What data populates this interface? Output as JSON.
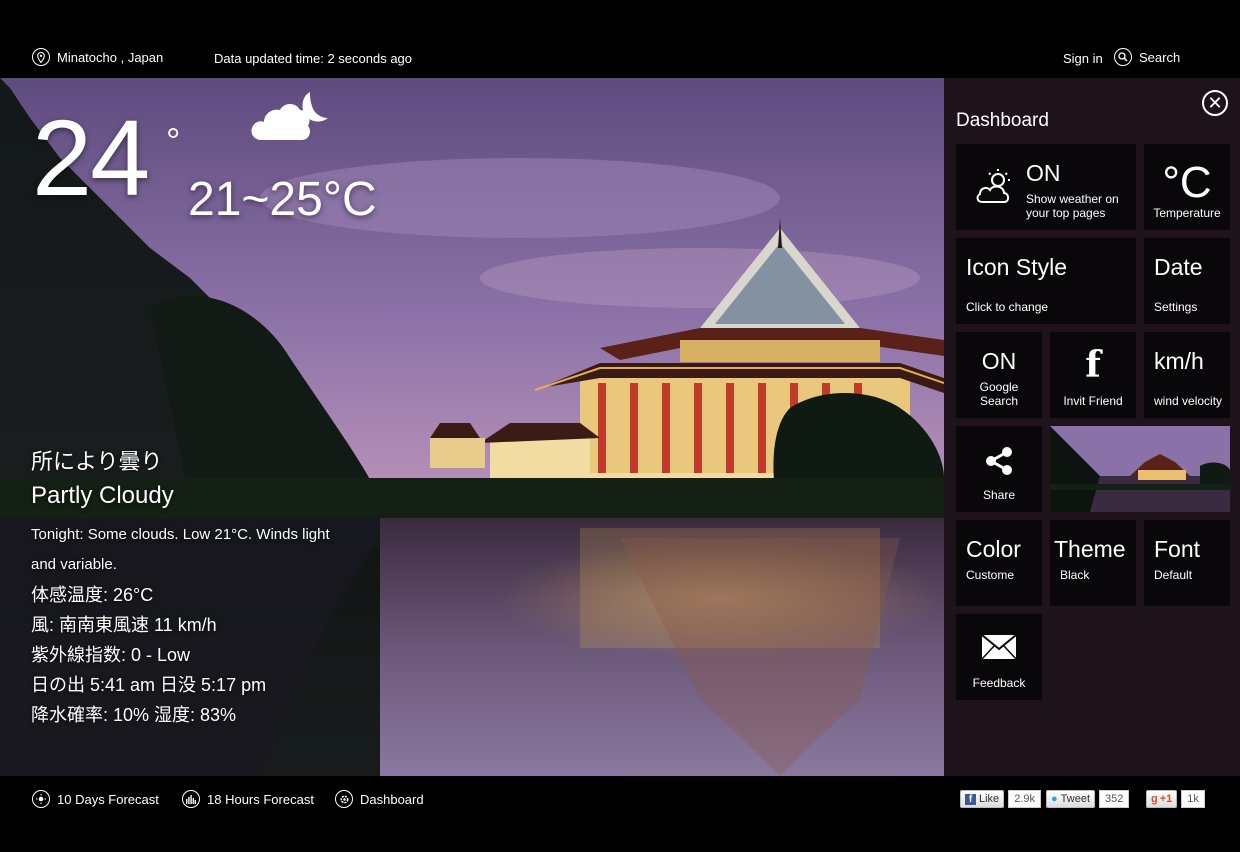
{
  "top": {
    "location": "Minatocho , Japan",
    "updated": "Data updated time: 2 seconds ago",
    "signin": "Sign in",
    "search": "Search"
  },
  "weather": {
    "temp": "24",
    "deg": "°",
    "range": "21~25°C",
    "cond_ja": "所により曇り",
    "cond_en": "Partly Cloudy",
    "desc": "Tonight: Some clouds. Low 21°C. Winds light and variable.",
    "feels": "体感温度: 26°C",
    "wind": "風: 南南東風速 11 km/h",
    "uv": "紫外線指数: 0 - Low",
    "sun": "日の出 5:41 am 日没 5:17 pm",
    "precip": "降水確率: 10% 湿度: 83%",
    "icon": "cloud-moon-icon"
  },
  "dashboard": {
    "title": "Dashboard",
    "weather_toggle": {
      "state": "ON",
      "label": "Show weather on your top pages"
    },
    "temperature": {
      "unit": "°C",
      "label": "Temperature"
    },
    "icon_style": {
      "title": "Icon Style",
      "label": "Click to change"
    },
    "date": {
      "title": "Date",
      "label": "Settings"
    },
    "google": {
      "state": "ON",
      "label": "Google Search"
    },
    "invite": {
      "glyph": "f",
      "label": "Invit Friend"
    },
    "wind": {
      "unit": "km/h",
      "label": "wind velocity"
    },
    "share": {
      "label": "Share"
    },
    "color": {
      "title": "Color",
      "label": "Custome"
    },
    "theme": {
      "title": "Theme",
      "label": "Black"
    },
    "font": {
      "title": "Font",
      "label": "Default"
    },
    "feedback": {
      "label": "Feedback"
    }
  },
  "bottom": {
    "days": "10 Days Forecast",
    "hours": "18 Hours Forecast",
    "dashboard": "Dashboard",
    "social": {
      "like": "Like",
      "like_count": "2.9k",
      "tweet": "Tweet",
      "tweet_count": "352",
      "gplus": "+1",
      "gplus_count": "1k"
    }
  },
  "colors": {
    "sky_top": "#6e5a8e",
    "sky_mid": "#9c7fb2",
    "panel": "#23161e",
    "roof": "#b9352a"
  }
}
